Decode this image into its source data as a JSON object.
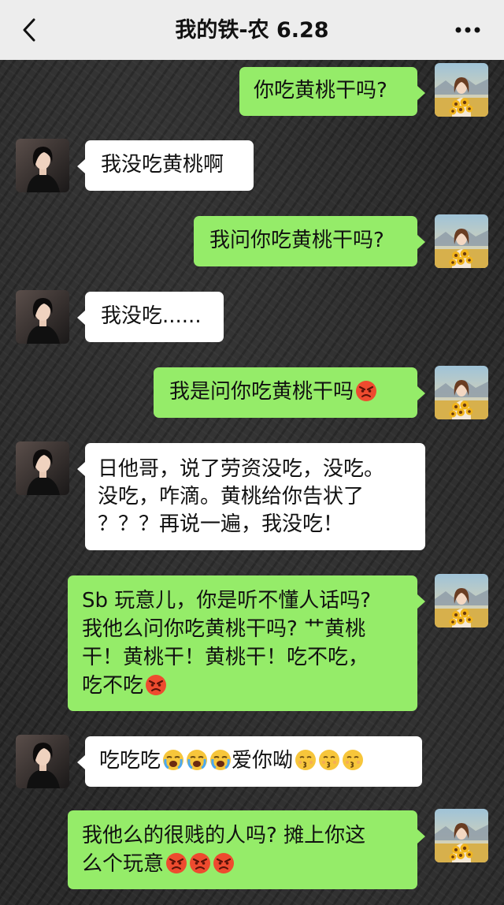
{
  "header": {
    "title": "我的铁-农 6.28",
    "back_icon": "chevron-left-icon",
    "more_icon": "more-dots-icon"
  },
  "colors": {
    "sent_bubble": "#95ec69",
    "received_bubble": "#ffffff",
    "header_bg": "#ededed",
    "chat_bg": "#2b2b2b"
  },
  "messages": [
    {
      "side": "sent",
      "text": "你吃黄桃干吗?",
      "emoji": []
    },
    {
      "side": "received",
      "text": "我没吃黄桃啊",
      "emoji": []
    },
    {
      "side": "sent",
      "text": "我问你吃黄桃干吗?",
      "emoji": []
    },
    {
      "side": "received",
      "text": "我没吃......",
      "emoji": []
    },
    {
      "side": "sent",
      "text": "我是问你吃黄桃干吗",
      "emoji": [
        "angry-face"
      ]
    },
    {
      "side": "received",
      "text": "日他哥，说了劳资没吃，没吃。\n没吃，咋滴。黄桃给你告状了\n？？？再说一遍，我没吃！",
      "emoji": []
    },
    {
      "side": "sent",
      "text": "Sb 玩意儿，你是听不懂人话吗?\n我他么问你吃黄桃干吗? 艹黄桃\n干！黄桃干！黄桃干！吃不吃，\n吃不吃",
      "emoji": [
        "angry-face"
      ]
    },
    {
      "side": "received",
      "text": "吃吃吃",
      "emoji": [
        "loudly-crying-face",
        "loudly-crying-face",
        "loudly-crying-face"
      ],
      "text_after": "爱你呦",
      "emoji_after": [
        "kissing-face",
        "kissing-face",
        "kissing-face"
      ]
    },
    {
      "side": "sent",
      "text": "我他么的很贱的人吗? 摊上你这\n么个玩意",
      "emoji": [
        "angry-face",
        "angry-face",
        "angry-face"
      ]
    }
  ]
}
